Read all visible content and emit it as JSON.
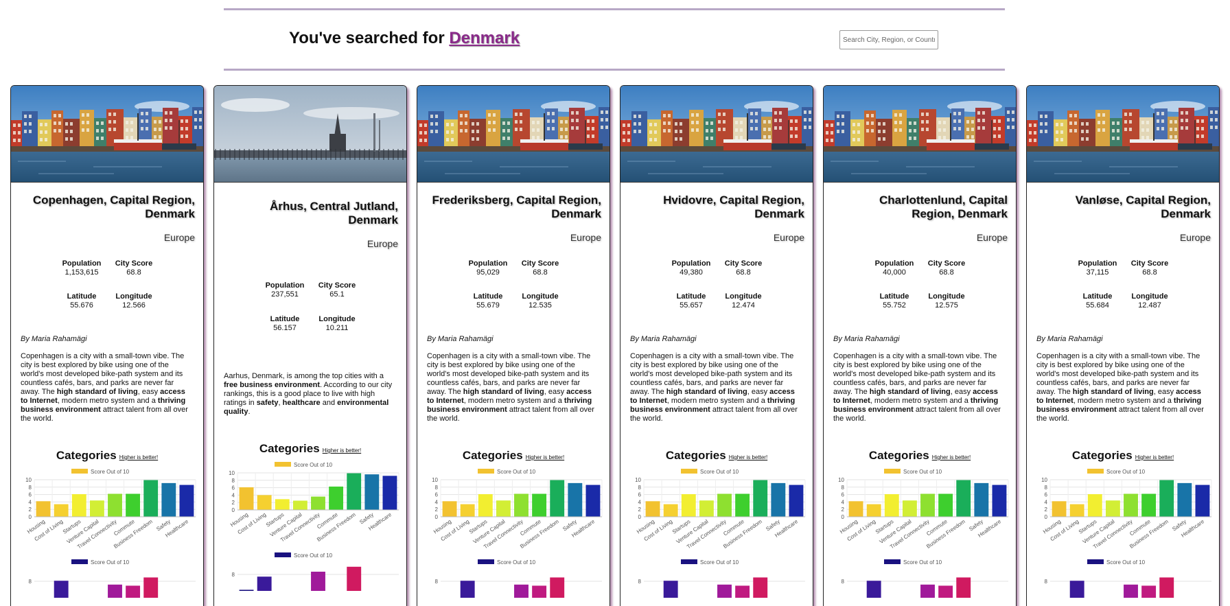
{
  "header": {
    "prefix": "You've searched for ",
    "query": "Denmark",
    "search_placeholder": "Search City, Region, or Country"
  },
  "common": {
    "categories_title": "Categories",
    "higher_better": "Higher is better!",
    "legend_label": "Score Out of 10",
    "labels": {
      "population": "Population",
      "city_score": "City Score",
      "latitude": "Latitude",
      "longitude": "Longitude"
    }
  },
  "cards": [
    {
      "name": "Copenhagen, Capital Region, Denmark",
      "continent": "Europe",
      "population": "1,153,615",
      "city_score": "68.8",
      "latitude": "55.676",
      "longitude": "12.566",
      "author": "By Maria Rahamägi",
      "desc_html": "Copenhagen is a city with a small-town vibe. The city is best explored by bike using one of the world's most developed bike-path system and its countless cafés, bars, and parks are never far away. The <b>high standard of living</b>, easy <b>access to Internet</b>, modern metro system and a <b>thriving business environment</b> attract talent from all over the world.",
      "photo": "nyhavn"
    },
    {
      "name": "Århus, Central Jutland, Denmark",
      "continent": "Europe",
      "population": "237,551",
      "city_score": "65.1",
      "latitude": "56.157",
      "longitude": "10.211",
      "author": "",
      "desc_html": "Aarhus, Denmark, is among the top cities with a <b>free business environment</b>. According to our city rankings, this is a good place to live with high ratings in <b>safety</b>, <b>healthcare</b> and <b>environmental quality</b>.",
      "photo": "aarhus"
    },
    {
      "name": "Frederiksberg, Capital Region, Denmark",
      "continent": "Europe",
      "population": "95,029",
      "city_score": "68.8",
      "latitude": "55.679",
      "longitude": "12.535",
      "author": "By Maria Rahamägi",
      "desc_html": "Copenhagen is a city with a small-town vibe. The city is best explored by bike using one of the world's most developed bike-path system and its countless cafés, bars, and parks are never far away. The <b>high standard of living</b>, easy <b>access to Internet</b>, modern metro system and a <b>thriving business environment</b> attract talent from all over the world.",
      "photo": "nyhavn"
    },
    {
      "name": "Hvidovre, Capital Region, Denmark",
      "continent": "Europe",
      "population": "49,380",
      "city_score": "68.8",
      "latitude": "55.657",
      "longitude": "12.474",
      "author": "By Maria Rahamägi",
      "desc_html": "Copenhagen is a city with a small-town vibe. The city is best explored by bike using one of the world's most developed bike-path system and its countless cafés, bars, and parks are never far away. The <b>high standard of living</b>, easy <b>access to Internet</b>, modern metro system and a <b>thriving business environment</b> attract talent from all over the world.",
      "photo": "nyhavn"
    },
    {
      "name": "Charlottenlund, Capital Region, Denmark",
      "continent": "Europe",
      "population": "40,000",
      "city_score": "68.8",
      "latitude": "55.752",
      "longitude": "12.575",
      "author": "By Maria Rahamägi",
      "desc_html": "Copenhagen is a city with a small-town vibe. The city is best explored by bike using one of the world's most developed bike-path system and its countless cafés, bars, and parks are never far away. The <b>high standard of living</b>, easy <b>access to Internet</b>, modern metro system and a <b>thriving business environment</b> attract talent from all over the world.",
      "photo": "nyhavn"
    },
    {
      "name": "Vanløse, Capital Region, Denmark",
      "continent": "Europe",
      "population": "37,115",
      "city_score": "68.8",
      "latitude": "55.684",
      "longitude": "12.487",
      "author": "By Maria Rahamägi",
      "desc_html": "Copenhagen is a city with a small-town vibe. The city is best explored by bike using one of the world's most developed bike-path system and its countless cafés, bars, and parks are never far away. The <b>high standard of living</b>, easy <b>access to Internet</b>, modern metro system and a <b>thriving business environment</b> attract talent from all over the world.",
      "photo": "nyhavn"
    }
  ],
  "chart_data": [
    {
      "type": "bar",
      "title": "",
      "categories": [
        "Housing",
        "Cost of Living",
        "Startups",
        "Venture Capital",
        "Travel Connectivity",
        "Commute",
        "Business Freedom",
        "Safety",
        "Healthcare"
      ],
      "series": [
        {
          "name": "Score Out of 10",
          "values": [
            4.2,
            3.4,
            6.1,
            4.4,
            6.2,
            6.2,
            9.9,
            9.1,
            8.6
          ]
        }
      ],
      "colors": [
        "#f2c230",
        "#f5d030",
        "#f2ee30",
        "#d2ee35",
        "#8ee030",
        "#3ecf2e",
        "#1aae5a",
        "#1874a8",
        "#1a2aa8"
      ],
      "ylim": [
        0,
        10
      ],
      "yticks": [
        0,
        2,
        4,
        6,
        8,
        10
      ],
      "grid": true,
      "legend": "top"
    },
    {
      "type": "bar",
      "title": "",
      "categories": [
        "Housing",
        "Cost of Living",
        "Startups",
        "Venture Capital",
        "Travel Connectivity",
        "Commute",
        "Business Freedom",
        "Safety",
        "Healthcare"
      ],
      "series": [
        {
          "name": "Score Out of 10",
          "values": [
            6.1,
            4.0,
            2.9,
            2.5,
            3.6,
            6.3,
            9.9,
            9.6,
            9.2
          ]
        }
      ],
      "colors": [
        "#f2c230",
        "#f5d030",
        "#f2ee30",
        "#d2ee35",
        "#8ee030",
        "#3ecf2e",
        "#1aae5a",
        "#1874a8",
        "#1a2aa8"
      ],
      "ylim": [
        0,
        10
      ],
      "yticks": [
        0,
        2,
        4,
        6,
        8,
        10
      ],
      "grid": true,
      "legend": "top"
    }
  ],
  "chart2_colors": [
    "#1a1280",
    "#3a1a9a",
    "#5a1a9a",
    "#7a1aa0",
    "#a01a9a",
    "#c01a80",
    "#d01a60",
    "#e01a40",
    "#e81a2a"
  ],
  "chart2_values_card": [
    null,
    8.1,
    null,
    null,
    7.4,
    7.2,
    8.7,
    null,
    null
  ],
  "chart2_values_aarhus": [
    5.2,
    7.6,
    4.6,
    4.8,
    8.5,
    null,
    9.4,
    null,
    null
  ]
}
